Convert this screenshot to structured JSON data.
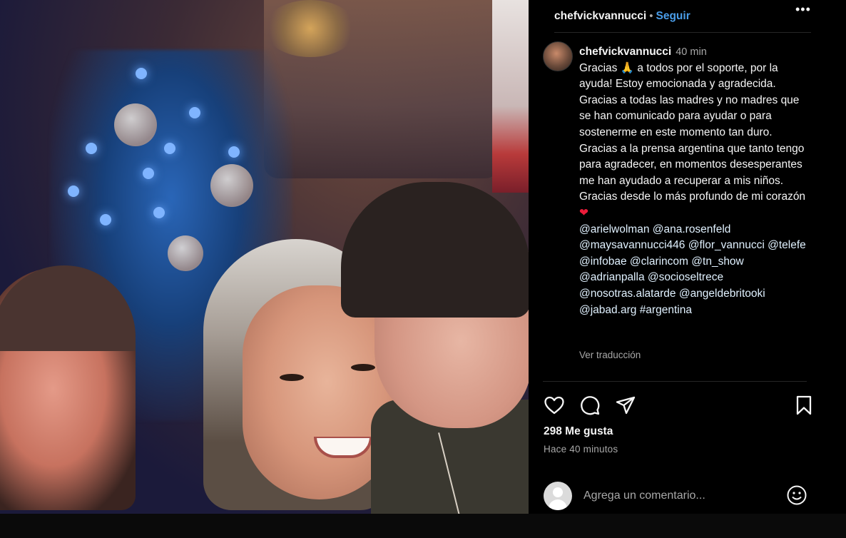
{
  "post": {
    "username": "chefvickvannucci",
    "separator": "•",
    "follow_label": "Seguir",
    "more_label": "•••"
  },
  "caption": {
    "username": "chefvickvannucci",
    "time": "40 min",
    "line1": "Gracias 🙏 a todos por el soporte, por la ayuda! Estoy emocionada y agradecida. Gracias a todas las madres y no madres que se han comunicado para ayudar o para sostenerme en este momento tan duro.",
    "line2": "Gracias a la prensa argentina que tanto tengo para agradecer, en momentos desesperantes me han ayudado a recuperar a mis niños.",
    "line3": "Gracias desde lo más profundo de mi corazón",
    "heart": "❤",
    "mentions": [
      "@arielwolman",
      "@ana.rosenfeld",
      "@maysavannucci446",
      "@flor_vannucci",
      "@telefe",
      "@infobae",
      "@clarincom",
      "@tn_show",
      "@adrianpalla",
      "@socioseltrece",
      "@nosotras.alatarde",
      "@angeldebritooki",
      "@jabad.arg",
      "#argentina"
    ],
    "translate_label": "Ver traducción"
  },
  "actions": {
    "icons": [
      "heart-icon",
      "comment-icon",
      "share-icon",
      "bookmark-icon"
    ],
    "likes": "298 Me gusta",
    "posted": "Hace 40 minutos"
  },
  "comment": {
    "placeholder": "Agrega un comentario...",
    "emoji_icon": "smile-icon"
  },
  "colors": {
    "accent": "#4a9de9",
    "background": "#000000",
    "muted": "#a8a8a8",
    "heart": "#ed1c3a"
  }
}
